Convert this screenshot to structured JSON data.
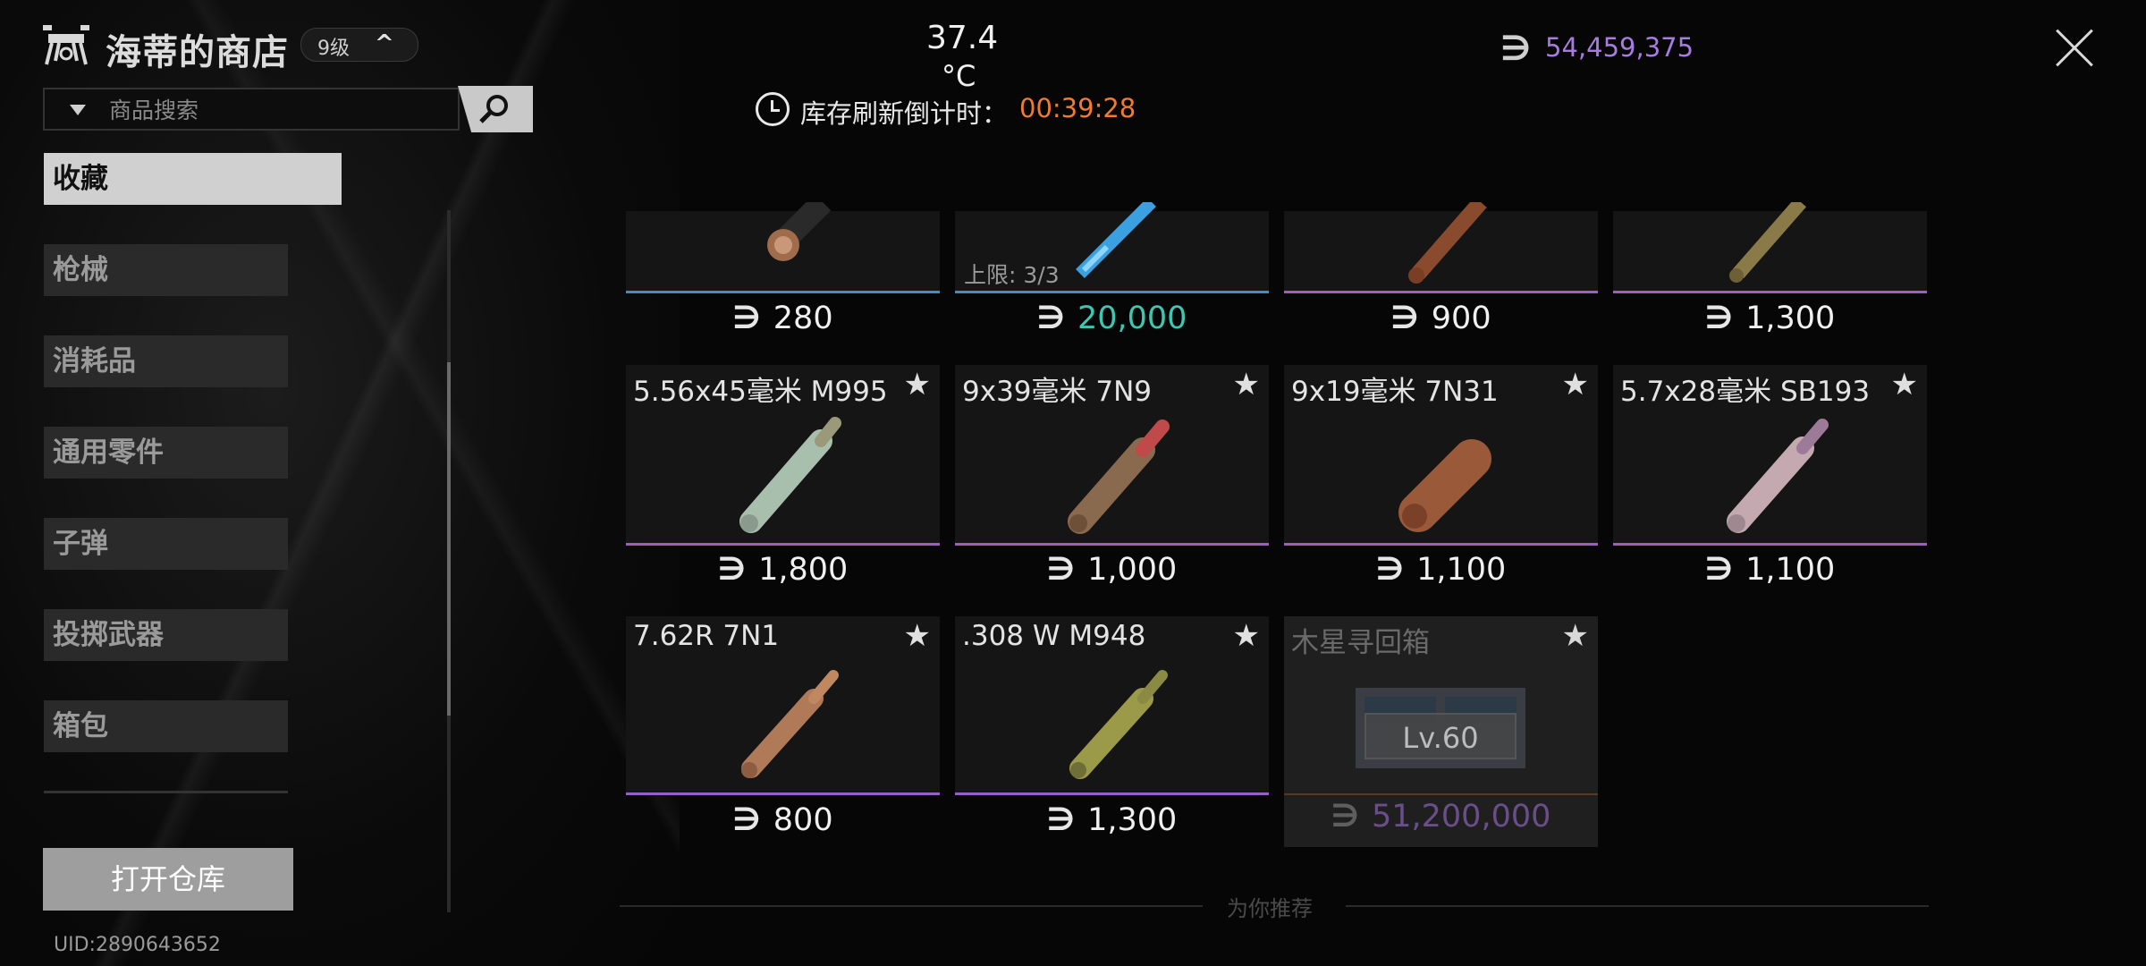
{
  "header": {
    "shop_title": "海蒂的商店",
    "level": "9级",
    "temperature": "37.4",
    "temperature_unit": "°C",
    "refresh_label": "库存刷新倒计时：",
    "refresh_countdown": "00:39:28",
    "currency_symbol": "∋",
    "balance": "54,459,375"
  },
  "search": {
    "placeholder": "商品搜索"
  },
  "sidebar": {
    "categories": [
      "收藏",
      "枪械",
      "消耗品",
      "通用零件",
      "子弹",
      "投掷武器",
      "箱包"
    ],
    "active_index": 0,
    "open_warehouse": "打开仓库",
    "uid": "UID:2890643652"
  },
  "grid": {
    "row1": [
      {
        "price": "280",
        "rarity": "blue"
      },
      {
        "price": "20,000",
        "rarity": "blue",
        "limit_label": "上限:",
        "limit_value": "3/3"
      },
      {
        "price": "900",
        "rarity": "purple"
      },
      {
        "price": "1,300",
        "rarity": "purple"
      }
    ],
    "row2": [
      {
        "name": "5.56x45毫米 M995",
        "price": "1,800",
        "rarity": "purple"
      },
      {
        "name": "9x39毫米 7N9",
        "price": "1,000",
        "rarity": "purple"
      },
      {
        "name": "9x19毫米 7N31",
        "price": "1,100",
        "rarity": "purple"
      },
      {
        "name": "5.7x28毫米  SB193",
        "price": "1,100",
        "rarity": "purple"
      }
    ],
    "row3": [
      {
        "name": "7.62R 7N1",
        "price": "800",
        "rarity": "purple"
      },
      {
        "name": ".308 W M948",
        "price": "1,300",
        "rarity": "purple"
      },
      {
        "name": "木星寻回箱",
        "price": "51,200,000",
        "rarity": "orange",
        "locked_level": "Lv.60"
      }
    ]
  },
  "footer": {
    "recommend": "为你推荐"
  },
  "colors": {
    "blue_rarity": "#4d86c6",
    "purple_rarity": "#9a5fc0",
    "teal_price": "#3fc6b0",
    "orange_countdown": "#f07a32",
    "balance_purple": "#a77be0"
  }
}
